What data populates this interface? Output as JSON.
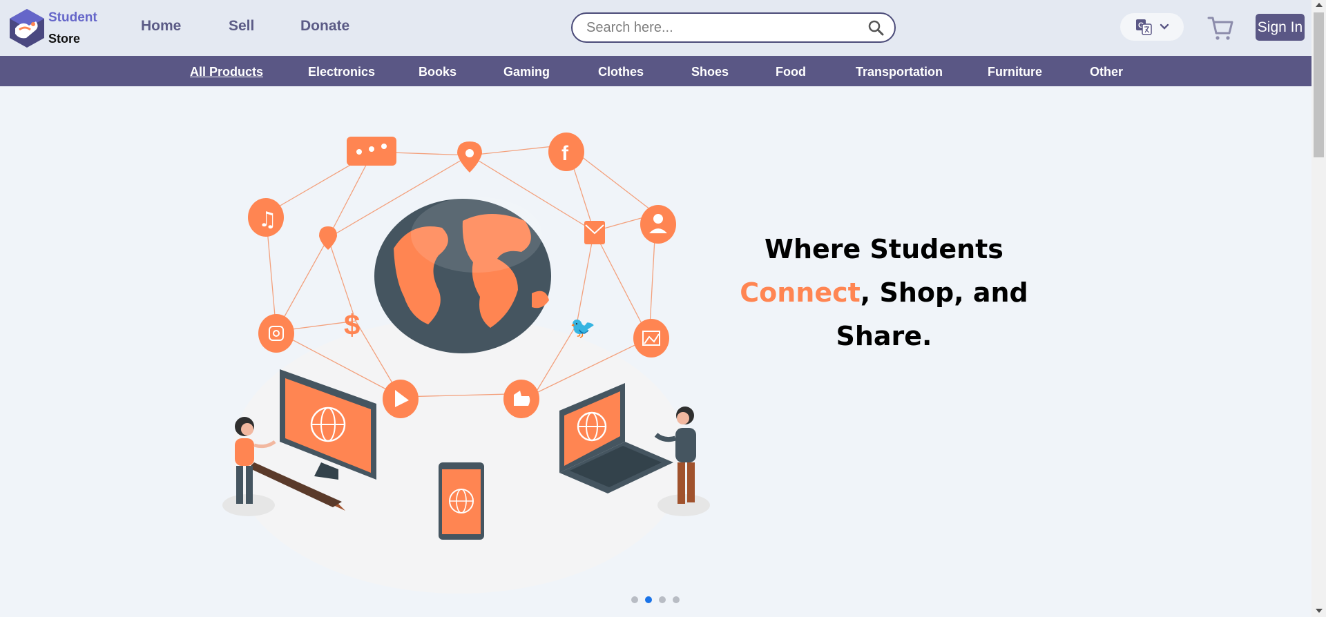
{
  "header": {
    "logo_line1": "Student",
    "logo_line2": "Store",
    "nav": {
      "home": "Home",
      "sell": "Sell",
      "donate": "Donate"
    },
    "search_placeholder": "Search here...",
    "signin": "Sign In"
  },
  "categories": [
    "All Products",
    "Electronics",
    "Books",
    "Gaming",
    "Clothes",
    "Shoes",
    "Food",
    "Transportation",
    "Furniture",
    "Other"
  ],
  "hero": {
    "line1": "Where Students",
    "accent_word": "Connect",
    "line2_rest": ", Shop, and",
    "line3": "Share."
  },
  "carousel": {
    "slides": 4,
    "active_index": 1
  },
  "colors": {
    "brand": "#5a5785",
    "accent": "#ff8552",
    "logo_blue": "#6566c9",
    "dot_active": "#1a73e8"
  },
  "icons": [
    "search-icon",
    "translate-icon",
    "chevron-down-icon",
    "cart-icon"
  ]
}
